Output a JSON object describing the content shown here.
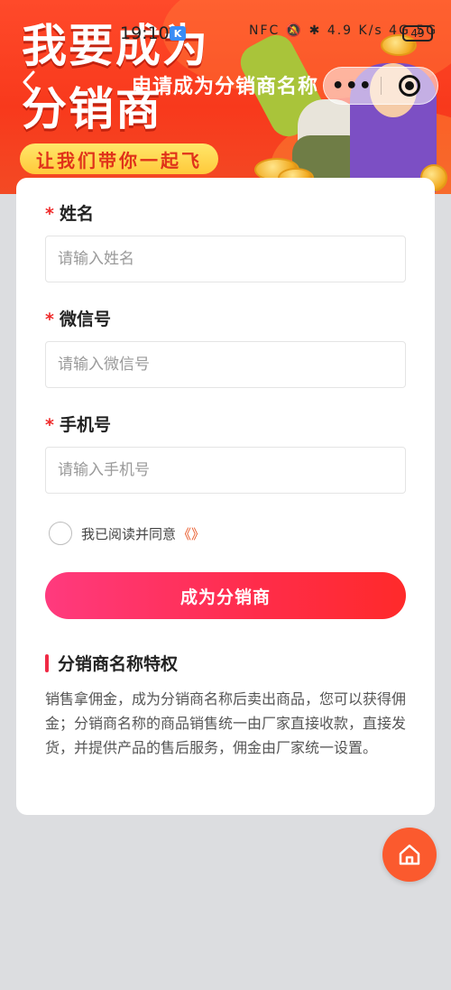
{
  "status_bar": {
    "time": "19:10",
    "badge": "K",
    "icons": "NFC 🔕 ✱ 4.9 K/s 4G 5G",
    "battery": "49"
  },
  "banner": {
    "headline_line1": "我要成为",
    "headline_line2": "分销商",
    "slogan": "让我们带你一起飞",
    "accent_color": "#f8391c"
  },
  "nav": {
    "back_icon": "chevron-left-icon",
    "title": "申请成为分销商名称",
    "more_label": "•••",
    "target_icon": "target-icon"
  },
  "form": {
    "name_label": "姓名",
    "name_placeholder": "请输入姓名",
    "name_value": "",
    "wechat_label": "微信号",
    "wechat_placeholder": "请输入微信号",
    "wechat_value": "",
    "phone_label": "手机号",
    "phone_placeholder": "请输入手机号",
    "phone_value": "",
    "required_mark": "*",
    "agree_text": "我已阅读并同意",
    "agree_link": "《》",
    "agree_checked": false,
    "submit_label": "成为分销商",
    "submit_gradient": [
      "#ff3a7e",
      "#ff2a2a"
    ]
  },
  "privileges": {
    "title": "分销商名称特权",
    "body": "销售拿佣金，成为分销商名称后卖出商品，您可以获得佣金；分销商名称的商品销售统一由厂家直接收款，直接发货，并提供产品的售后服务，佣金由厂家统一设置。"
  },
  "home_fab": {
    "icon": "home-icon",
    "color": "#fb5a2e"
  }
}
